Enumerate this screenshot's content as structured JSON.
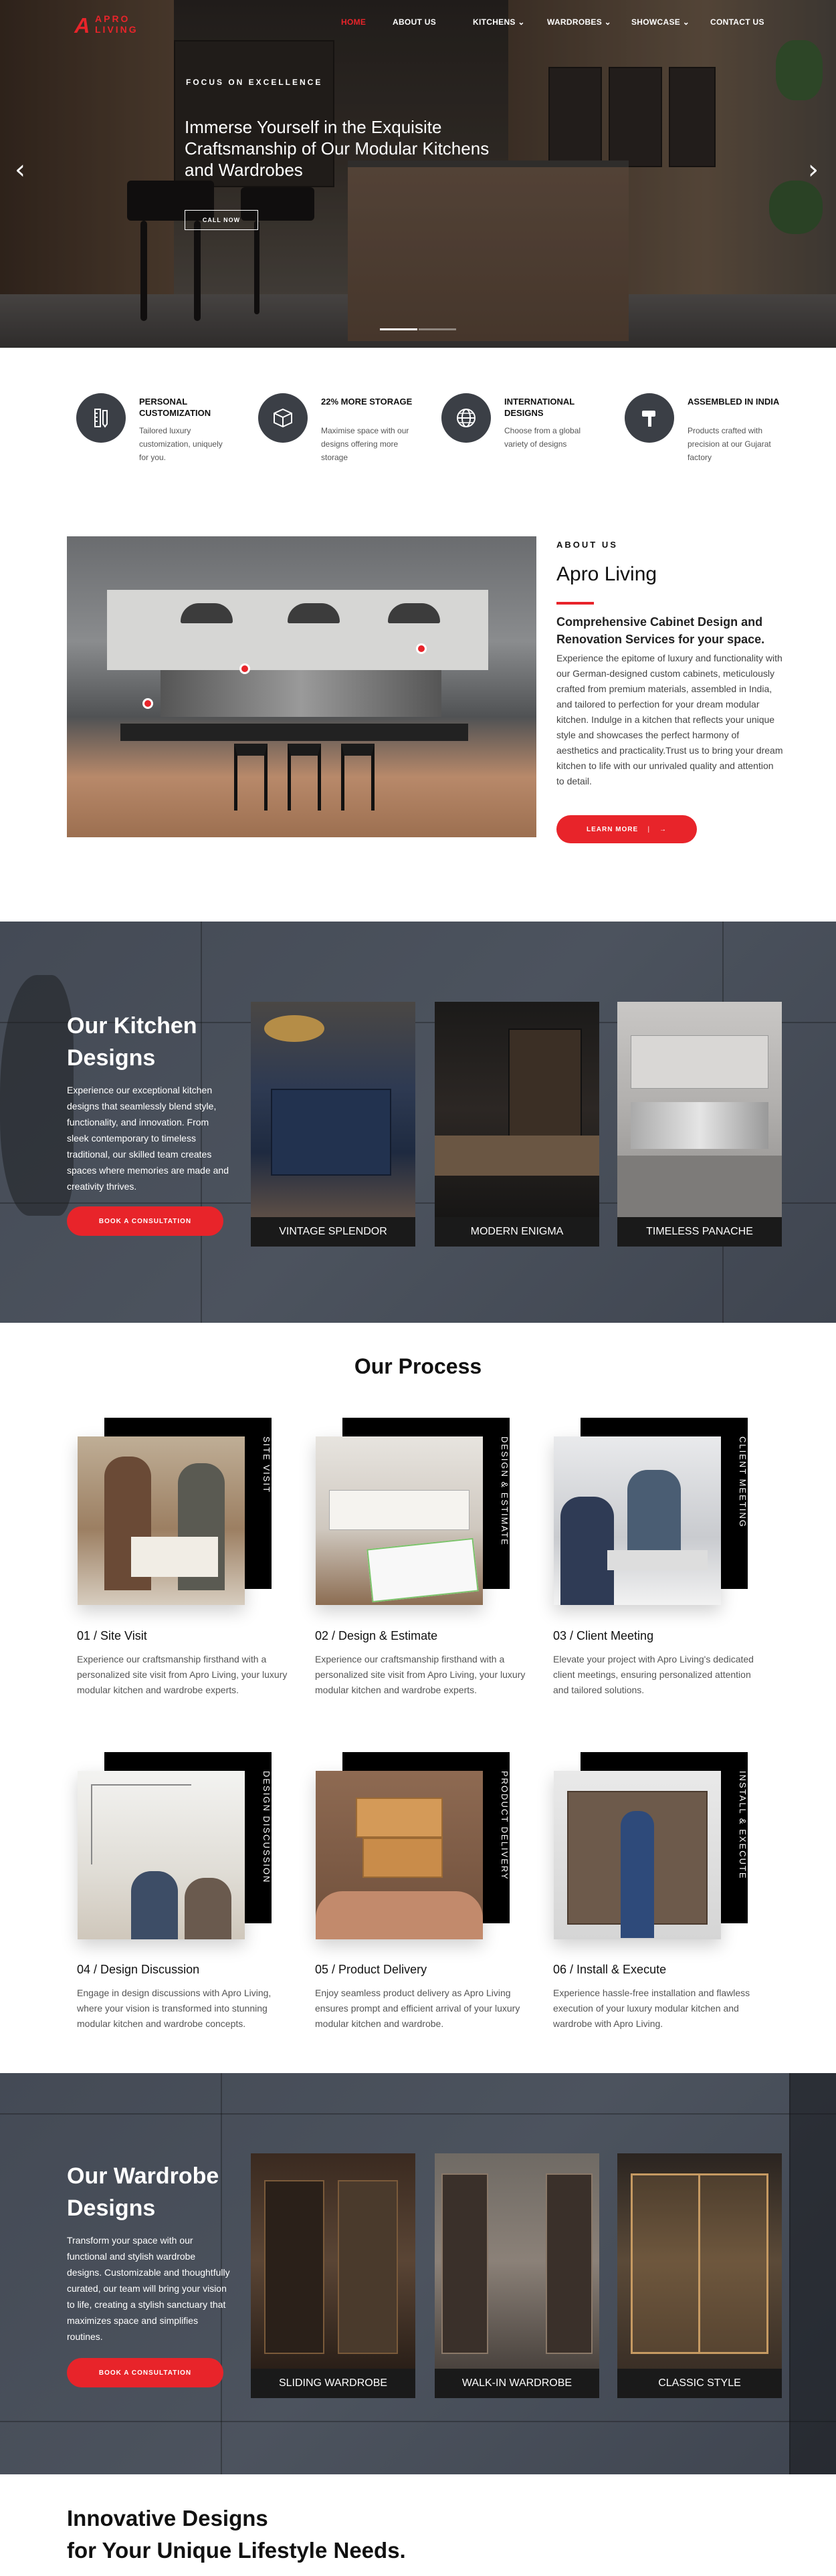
{
  "brand": {
    "mark": "A",
    "line1": "APRO",
    "line2": "LIVING",
    "accent": "#e8242a"
  },
  "nav": {
    "items": [
      {
        "label": "HOME",
        "active": true
      },
      {
        "label": "ABOUT US"
      },
      {
        "label": "KITCHENS ⌄"
      },
      {
        "label": "WARDROBES ⌄"
      },
      {
        "label": "SHOWCASE ⌄"
      },
      {
        "label": "CONTACT US"
      }
    ]
  },
  "hero": {
    "kicker": "FOCUS ON EXCELLENCE",
    "title": "Immerse Yourself in the Exquisite Craftsmanship of Our Modular Kitchens and Wardrobes",
    "button": "CALL NOW",
    "prev": "‹",
    "next": "›",
    "slides": 2,
    "active_slide": 1
  },
  "features": [
    {
      "icon": "ruler-pencil-icon",
      "title": "PERSONAL CUSTOMIZATION",
      "text": "Tailored luxury customization, uniquely for you."
    },
    {
      "icon": "box-icon",
      "title": "22% MORE STORAGE",
      "text": "Maximise space with our designs offering more storage"
    },
    {
      "icon": "globe-icon",
      "title": "INTERNATIONAL DESIGNS",
      "text": "Choose from a global variety of designs"
    },
    {
      "icon": "hammer-icon",
      "title": "ASSEMBLED IN INDIA",
      "text": "Products crafted with precision at our Gujarat factory"
    }
  ],
  "about": {
    "kicker": "ABOUT US",
    "title": "Apro Living",
    "subtitle": "Comprehensive Cabinet Design and Renovation Services for your space.",
    "text": "Experience the epitome of luxury and functionality with our German-designed custom cabinets, meticulously crafted from premium materials, assembled in India, and tailored to perfection for your dream modular kitchen. Indulge in a kitchen that reflects your unique style and showcases the perfect harmony of aesthetics and practicality.Trust us to bring your dream kitchen to life with our unrivaled quality and attention to detail.",
    "button": "LEARN MORE",
    "button_arrow": "→"
  },
  "kitchens": {
    "title": "Our Kitchen Designs",
    "text": "Experience our exceptional kitchen designs that seamlessly blend style, functionality, and innovation. From sleek contemporary to timeless traditional, our skilled team creates spaces where memories are made and creativity thrives.",
    "button": "BOOK A CONSULTATION",
    "cards": [
      "VINTAGE SPLENDOR",
      "MODERN ENIGMA",
      "TIMELESS PANACHE"
    ]
  },
  "process": {
    "title": "Our Process",
    "steps": [
      {
        "label": "SITE VISIT",
        "title": "01 / Site Visit",
        "text": "Experience our craftsmanship firsthand with a personalized site visit from Apro Living, your luxury modular kitchen and wardrobe experts."
      },
      {
        "label": "DESIGN & ESTIMATE",
        "title": "02 / Design & Estimate",
        "text": "Experience our craftsmanship firsthand with a personalized site visit from Apro Living, your luxury modular kitchen and wardrobe experts."
      },
      {
        "label": "CLIENT MEETING",
        "title": "03 / Client Meeting",
        "text": "Elevate your project with Apro Living's dedicated client meetings, ensuring personalized attention and tailored solutions."
      },
      {
        "label": "DESIGN DISCUSSION",
        "title": "04 / Design Discussion",
        "text": "Engage in design discussions with Apro Living, where your vision is transformed into stunning modular kitchen and wardrobe concepts."
      },
      {
        "label": "PRODUCT DELIVERY",
        "title": "05 / Product Delivery",
        "text": "Enjoy seamless product delivery as Apro Living ensures prompt and efficient arrival of your luxury modular kitchen and wardrobe."
      },
      {
        "label": "INSTALL & EXECUTE",
        "title": "06 / Install & Execute",
        "text": "Experience hassle-free installation and flawless execution of your luxury modular kitchen and wardrobe with Apro Living."
      }
    ]
  },
  "wardrobes": {
    "title": "Our Wardrobe Designs",
    "text": "Transform your space with our functional and stylish wardrobe designs. Customizable and thoughtfully curated, our team will bring your vision to life, creating a stylish sanctuary that maximizes space and simplifies routines.",
    "button": "BOOK A CONSULTATION",
    "cards": [
      "SLIDING WARDROBE",
      "WALK-IN WARDROBE",
      "CLASSIC STYLE"
    ]
  },
  "closing": {
    "line1": "Innovative Designs",
    "line2": "for Your Unique Lifestyle Needs."
  }
}
